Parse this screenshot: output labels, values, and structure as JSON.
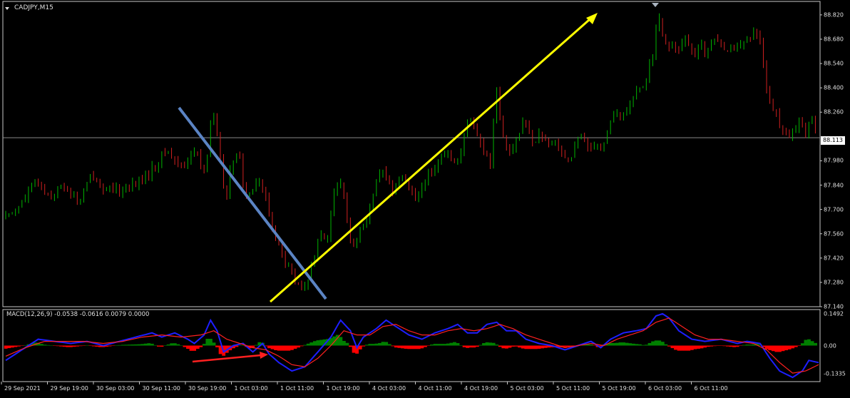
{
  "window": {
    "symbol_title": "CADJPY,M15",
    "macd_label": "MACD(12,26,9) -0.0538 -0.0616 0.0079 0.0000",
    "current_price": "88.113"
  },
  "colors": {
    "background": "#000000",
    "candle_bull": "#00b400",
    "candle_bear": "#d02020",
    "macd_hist_positive": "#008000",
    "macd_hist_negative": "#ff0000",
    "macd_line": "#1e1eff",
    "signal_line": "#ff2020",
    "downtrend_line": "#5b84c4",
    "uptrend_arrow": "#ffff00",
    "divergence_arrow": "#ff2020"
  },
  "icons": {
    "title_marker": "triangle-down-icon",
    "chart_shift_marker": "triangle-down-icon"
  },
  "chart_data": [
    {
      "type": "candlestick",
      "name": "CADJPY,M15",
      "price_axis_ticks": [
        "88.820",
        "88.680",
        "88.540",
        "88.400",
        "88.260",
        "88.113",
        "87.980",
        "87.840",
        "87.700",
        "87.560",
        "87.420",
        "87.280",
        "87.140"
      ],
      "time_axis_ticks": [
        "29 Sep 2021",
        "29 Sep 19:00",
        "30 Sep 03:00",
        "30 Sep 11:00",
        "30 Sep 19:00",
        "1 Oct 03:00",
        "1 Oct 11:00",
        "1 Oct 19:00",
        "4 Oct 03:00",
        "4 Oct 11:00",
        "4 Oct 19:00",
        "5 Oct 03:00",
        "5 Oct 11:00",
        "5 Oct 19:00",
        "6 Oct 03:00",
        "6 Oct 11:00"
      ],
      "ylim": [
        87.14,
        88.84
      ],
      "current_price": 88.113,
      "price_path": [
        [
          0,
          87.65
        ],
        [
          6,
          87.75
        ],
        [
          10,
          87.86
        ],
        [
          14,
          87.78
        ],
        [
          19,
          87.84
        ],
        [
          23,
          87.74
        ],
        [
          27,
          87.9
        ],
        [
          32,
          87.8
        ],
        [
          37,
          87.82
        ],
        [
          42,
          87.86
        ],
        [
          46,
          87.94
        ],
        [
          50,
          88.05
        ],
        [
          53,
          87.96
        ],
        [
          56,
          87.97
        ],
        [
          59,
          88.04
        ],
        [
          62,
          87.88
        ],
        [
          64,
          88.3
        ],
        [
          66,
          88.1
        ],
        [
          68,
          87.72
        ],
        [
          70,
          87.97
        ],
        [
          72,
          88.05
        ],
        [
          74,
          87.76
        ],
        [
          78,
          87.88
        ],
        [
          80,
          87.8
        ],
        [
          82,
          87.62
        ],
        [
          84,
          87.52
        ],
        [
          86,
          87.4
        ],
        [
          88,
          87.35
        ],
        [
          90,
          87.26
        ],
        [
          92,
          87.22
        ],
        [
          93,
          87.28
        ],
        [
          95,
          87.4
        ],
        [
          97,
          87.6
        ],
        [
          99,
          87.48
        ],
        [
          101,
          87.75
        ],
        [
          103,
          87.88
        ],
        [
          105,
          87.72
        ],
        [
          107,
          87.46
        ],
        [
          110,
          87.6
        ],
        [
          112,
          87.68
        ],
        [
          114,
          87.82
        ],
        [
          116,
          87.92
        ],
        [
          118,
          87.86
        ],
        [
          120,
          87.8
        ],
        [
          122,
          87.92
        ],
        [
          124,
          87.86
        ],
        [
          126,
          87.75
        ],
        [
          128,
          87.82
        ],
        [
          130,
          87.9
        ],
        [
          132,
          87.94
        ],
        [
          134,
          87.98
        ],
        [
          137,
          88.02
        ],
        [
          140,
          87.96
        ],
        [
          142,
          88.18
        ],
        [
          144,
          88.22
        ],
        [
          146,
          88.1
        ],
        [
          148,
          88.02
        ],
        [
          150,
          87.96
        ],
        [
          151,
          88.48
        ],
        [
          153,
          88.15
        ],
        [
          155,
          88.05
        ],
        [
          158,
          88.1
        ],
        [
          160,
          88.24
        ],
        [
          162,
          88.08
        ],
        [
          165,
          88.14
        ],
        [
          167,
          88.05
        ],
        [
          170,
          88.1
        ],
        [
          172,
          88.02
        ],
        [
          174,
          87.98
        ],
        [
          176,
          88.08
        ],
        [
          178,
          88.13
        ],
        [
          180,
          88.05
        ],
        [
          182,
          88.1
        ],
        [
          184,
          88.04
        ],
        [
          186,
          88.2
        ],
        [
          188,
          88.26
        ],
        [
          190,
          88.22
        ],
        [
          192,
          88.3
        ],
        [
          195,
          88.38
        ],
        [
          197,
          88.4
        ],
        [
          198,
          88.52
        ],
        [
          200,
          88.6
        ],
        [
          201,
          88.84
        ],
        [
          202,
          88.72
        ],
        [
          204,
          88.66
        ],
        [
          207,
          88.62
        ],
        [
          210,
          88.68
        ],
        [
          212,
          88.56
        ],
        [
          214,
          88.64
        ],
        [
          216,
          88.6
        ],
        [
          218,
          88.68
        ],
        [
          220,
          88.7
        ],
        [
          222,
          88.62
        ],
        [
          224,
          88.66
        ],
        [
          226,
          88.62
        ],
        [
          228,
          88.66
        ],
        [
          230,
          88.7
        ],
        [
          232,
          88.74
        ],
        [
          233,
          88.62
        ],
        [
          235,
          88.32
        ],
        [
          237,
          88.26
        ],
        [
          239,
          88.18
        ],
        [
          241,
          88.1
        ],
        [
          243,
          88.14
        ],
        [
          245,
          88.22
        ],
        [
          247,
          88.08
        ],
        [
          248,
          88.3
        ],
        [
          249,
          88.18
        ],
        [
          250,
          88.1
        ]
      ]
    },
    {
      "type": "area",
      "name": "MACD(12,26,9)",
      "ylim": [
        -0.17,
        0.17
      ],
      "axis_ticks": [
        "0.1492",
        "0.00",
        "-0.1335"
      ],
      "macd_path": [
        [
          0,
          -0.07
        ],
        [
          5,
          -0.02
        ],
        [
          10,
          0.03
        ],
        [
          15,
          0.02
        ],
        [
          20,
          0.01
        ],
        [
          25,
          0.02
        ],
        [
          30,
          0.0
        ],
        [
          35,
          0.02
        ],
        [
          40,
          0.04
        ],
        [
          45,
          0.06
        ],
        [
          48,
          0.04
        ],
        [
          52,
          0.06
        ],
        [
          56,
          0.03
        ],
        [
          58,
          0.01
        ],
        [
          61,
          0.05
        ],
        [
          63,
          0.12
        ],
        [
          65,
          0.07
        ],
        [
          67,
          -0.03
        ],
        [
          70,
          0.0
        ],
        [
          73,
          0.01
        ],
        [
          76,
          -0.03
        ],
        [
          79,
          0.01
        ],
        [
          81,
          -0.04
        ],
        [
          84,
          -0.08
        ],
        [
          88,
          -0.12
        ],
        [
          92,
          -0.1
        ],
        [
          96,
          -0.03
        ],
        [
          100,
          0.04
        ],
        [
          103,
          0.12
        ],
        [
          106,
          0.07
        ],
        [
          108,
          -0.01
        ],
        [
          110,
          0.04
        ],
        [
          114,
          0.08
        ],
        [
          117,
          0.12
        ],
        [
          120,
          0.09
        ],
        [
          124,
          0.05
        ],
        [
          128,
          0.03
        ],
        [
          132,
          0.06
        ],
        [
          136,
          0.08
        ],
        [
          139,
          0.1
        ],
        [
          142,
          0.06
        ],
        [
          145,
          0.06
        ],
        [
          148,
          0.1
        ],
        [
          151,
          0.11
        ],
        [
          154,
          0.07
        ],
        [
          157,
          0.07
        ],
        [
          160,
          0.03
        ],
        [
          164,
          0.01
        ],
        [
          168,
          0.0
        ],
        [
          172,
          -0.02
        ],
        [
          176,
          0.0
        ],
        [
          180,
          0.02
        ],
        [
          183,
          -0.01
        ],
        [
          186,
          0.03
        ],
        [
          190,
          0.06
        ],
        [
          194,
          0.07
        ],
        [
          197,
          0.08
        ],
        [
          200,
          0.14
        ],
        [
          202,
          0.15
        ],
        [
          204,
          0.13
        ],
        [
          207,
          0.07
        ],
        [
          211,
          0.03
        ],
        [
          215,
          0.02
        ],
        [
          220,
          0.03
        ],
        [
          225,
          0.01
        ],
        [
          228,
          0.02
        ],
        [
          232,
          0.01
        ],
        [
          235,
          -0.06
        ],
        [
          238,
          -0.12
        ],
        [
          242,
          -0.15
        ],
        [
          245,
          -0.12
        ],
        [
          247,
          -0.07
        ],
        [
          250,
          -0.08
        ]
      ],
      "signal_path": [
        [
          0,
          -0.05
        ],
        [
          6,
          -0.01
        ],
        [
          12,
          0.02
        ],
        [
          18,
          0.02
        ],
        [
          24,
          0.02
        ],
        [
          30,
          0.01
        ],
        [
          36,
          0.02
        ],
        [
          42,
          0.04
        ],
        [
          48,
          0.05
        ],
        [
          54,
          0.04
        ],
        [
          60,
          0.05
        ],
        [
          64,
          0.07
        ],
        [
          68,
          0.03
        ],
        [
          72,
          0.01
        ],
        [
          76,
          -0.01
        ],
        [
          80,
          -0.02
        ],
        [
          84,
          -0.05
        ],
        [
          88,
          -0.09
        ],
        [
          92,
          -0.1
        ],
        [
          96,
          -0.06
        ],
        [
          100,
          0.0
        ],
        [
          104,
          0.07
        ],
        [
          108,
          0.05
        ],
        [
          112,
          0.05
        ],
        [
          116,
          0.09
        ],
        [
          120,
          0.1
        ],
        [
          124,
          0.07
        ],
        [
          128,
          0.05
        ],
        [
          132,
          0.05
        ],
        [
          136,
          0.07
        ],
        [
          140,
          0.08
        ],
        [
          144,
          0.07
        ],
        [
          148,
          0.08
        ],
        [
          152,
          0.1
        ],
        [
          156,
          0.08
        ],
        [
          160,
          0.05
        ],
        [
          164,
          0.03
        ],
        [
          168,
          0.01
        ],
        [
          172,
          -0.01
        ],
        [
          176,
          0.0
        ],
        [
          180,
          0.01
        ],
        [
          184,
          0.0
        ],
        [
          188,
          0.03
        ],
        [
          192,
          0.05
        ],
        [
          196,
          0.07
        ],
        [
          200,
          0.11
        ],
        [
          204,
          0.13
        ],
        [
          208,
          0.09
        ],
        [
          212,
          0.05
        ],
        [
          216,
          0.03
        ],
        [
          220,
          0.03
        ],
        [
          225,
          0.02
        ],
        [
          230,
          0.01
        ],
        [
          234,
          -0.02
        ],
        [
          238,
          -0.08
        ],
        [
          242,
          -0.13
        ],
        [
          246,
          -0.12
        ],
        [
          250,
          -0.09
        ]
      ]
    }
  ]
}
